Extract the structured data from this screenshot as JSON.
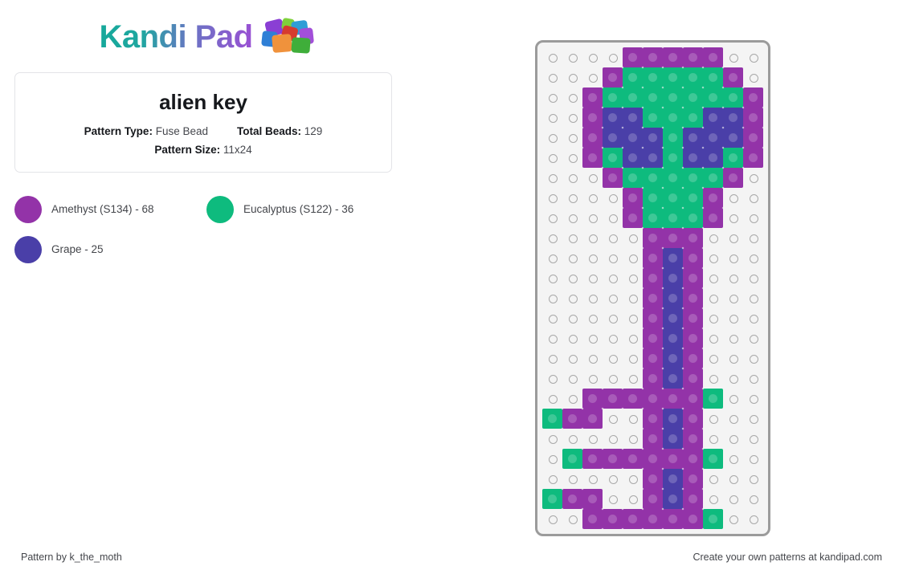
{
  "brand": {
    "name": "Kandi Pad",
    "logo_icon": "bead-pile-icon",
    "gradient_start": "#15a89a",
    "gradient_end": "#9b4fd4",
    "bead_icon_colors": [
      "#8a3fd4",
      "#2f7fd6",
      "#3fae3a",
      "#d63b2f",
      "#f0923c",
      "#7fd13b",
      "#2f9ed6",
      "#a24fd9"
    ]
  },
  "card": {
    "title": "alien key",
    "pattern_type_label": "Pattern Type:",
    "pattern_type_value": "Fuse Bead",
    "total_beads_label": "Total Beads:",
    "total_beads_value": "129",
    "pattern_size_label": "Pattern Size:",
    "pattern_size_value": "11x24"
  },
  "legend": [
    {
      "name": "Amethyst (S134) - 68",
      "color": "#9333a8",
      "key": "P"
    },
    {
      "name": "Eucalyptus (S122) - 36",
      "color": "#0ebb7e",
      "key": "G"
    },
    {
      "name": "Grape - 25",
      "color": "#4a3fa8",
      "key": "B"
    }
  ],
  "board": {
    "cols": 11,
    "rows": 24,
    "empty_color": "#f4f4f4",
    "peg_color": "#a8a8a8",
    "border_color": "#9b9b9b",
    "palette": {
      "P": "#9333a8",
      "G": "#0ebb7e",
      "B": "#4a3fa8",
      ".": ""
    },
    "pattern": [
      "....PPPPP..",
      "...PGGGGGP.",
      "..PGGGGGGGP",
      "..PBBGGGBBP",
      "..PBBBGBBBP",
      "..PGBBGBBGP",
      "...PGGGGGP.",
      "....PGGGP..",
      "....PGGGP..",
      ".....PPP...",
      ".....PBP...",
      ".....PBP...",
      ".....PBP...",
      ".....PBP...",
      ".....PBP...",
      ".....PBP...",
      ".....PBP...",
      "..PPPPPPG..",
      "GPP..PBP...",
      ".....PBP...",
      ".GPPPPPPG..",
      ".....PBP...",
      "GPP..PBP...",
      "..PPPPPPG.."
    ]
  },
  "footer": {
    "left": "Pattern by k_the_moth",
    "right": "Create your own patterns at kandipad.com"
  }
}
